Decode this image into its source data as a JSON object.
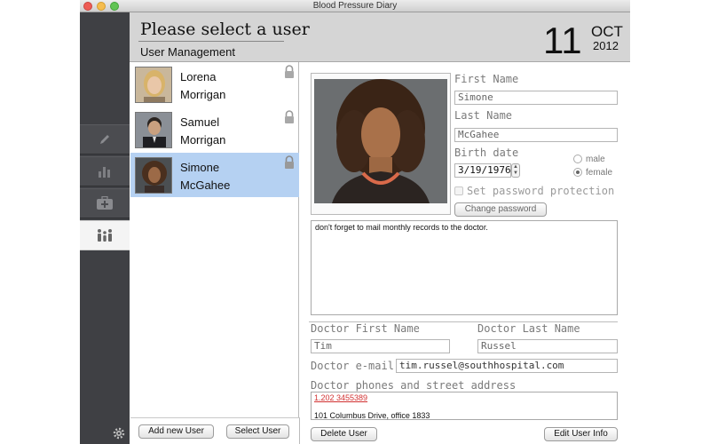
{
  "window": {
    "title": "Blood Pressure Diary"
  },
  "header": {
    "title": "Please select a user",
    "subtitle": "User Management",
    "date_day": "11",
    "date_month": "OCT",
    "date_year": "2012"
  },
  "sidebar": {
    "items": [
      {
        "icon": "pencil-icon"
      },
      {
        "icon": "bar-chart-icon"
      },
      {
        "icon": "medical-kit-icon"
      },
      {
        "icon": "users-icon",
        "active": true
      }
    ],
    "settings_icon": "gear-icon"
  },
  "users": [
    {
      "first": "Lorena",
      "last": "Morrigan",
      "locked": true
    },
    {
      "first": "Samuel",
      "last": "Morrigan",
      "locked": true
    },
    {
      "first": "Simone",
      "last": "McGahee",
      "locked": true,
      "selected": true
    }
  ],
  "list_buttons": {
    "add": "Add new User",
    "select": "Select User"
  },
  "detail": {
    "first_name_label": "First Name",
    "first_name": "Simone",
    "last_name_label": "Last Name",
    "last_name": "McGahee",
    "birth_date_label": "Birth date",
    "birth_date": "3/19/1976",
    "gender_male": "male",
    "gender_female": "female",
    "gender_selected": "female",
    "password_protection_label": "Set password protection",
    "change_password": "Change password",
    "notes": "don't forget to mail monthly records to the doctor.",
    "doctor_first_name_label": "Doctor First Name",
    "doctor_first_name": "Tim",
    "doctor_last_name_label": "Doctor Last Name",
    "doctor_last_name": "Russel",
    "doctor_email_label": "Doctor e-mail",
    "doctor_email": "tim.russel@southhospital.com",
    "doctor_phones_label": "Doctor phones and street address",
    "doctor_phone": "1.202 3455389",
    "doctor_address": "101 Columbus Drive, office 1833",
    "delete_user": "Delete User",
    "edit_user_info": "Edit User Info"
  },
  "colors": {
    "selected_row": "#b5d1f2",
    "sidebar_bg": "#3f4044",
    "header_bg": "#d5d5d5",
    "phone_link": "#d23131"
  }
}
